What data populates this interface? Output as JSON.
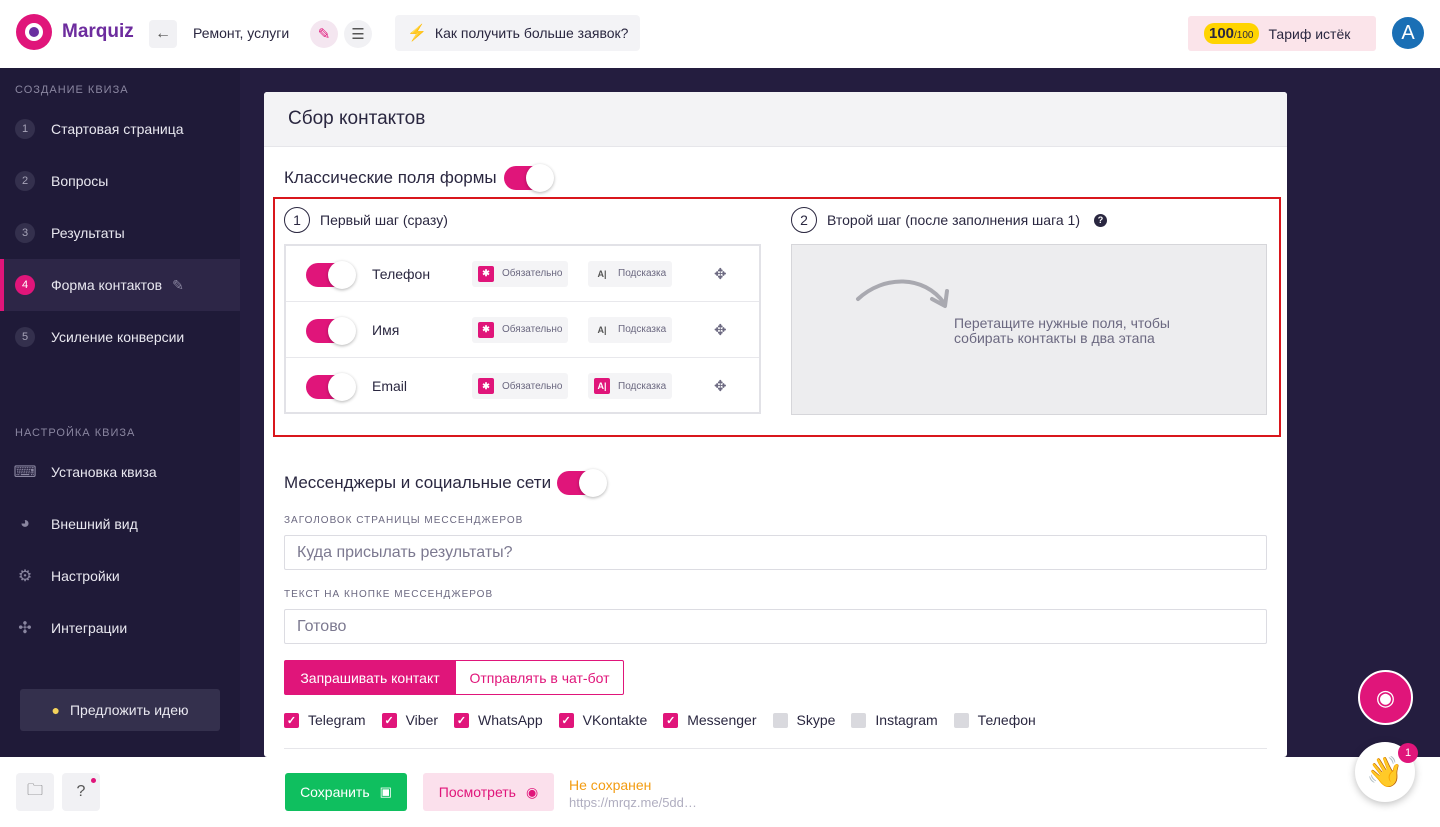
{
  "header": {
    "logo_text": "Marquiz",
    "quiz_name": "Ремонт, услуги",
    "tips_label": "Как получить больше заявок?",
    "tariff_count": "100",
    "tariff_total": "/100",
    "tariff_label": "Тариф истёк",
    "avatar_letter": "A"
  },
  "sidebar": {
    "section_create": "СОЗДАНИЕ КВИЗА",
    "steps": [
      {
        "num": "1",
        "label": "Стартовая страница"
      },
      {
        "num": "2",
        "label": "Вопросы"
      },
      {
        "num": "3",
        "label": "Результаты"
      },
      {
        "num": "4",
        "label": "Форма контактов"
      },
      {
        "num": "5",
        "label": "Усиление конверсии"
      }
    ],
    "section_settings": "НАСТРОЙКА КВИЗА",
    "settings": [
      {
        "label": "Установка квиза",
        "icon": "code-icon"
      },
      {
        "label": "Внешний вид",
        "icon": "palette-icon"
      },
      {
        "label": "Настройки",
        "icon": "gear-icon"
      },
      {
        "label": "Интеграции",
        "icon": "puzzle-icon"
      }
    ],
    "idea_label": "Предложить идею"
  },
  "main": {
    "title": "Сбор контактов",
    "classic_title": "Классические поля формы",
    "step1": {
      "num": "1",
      "label": "Первый шаг (сразу)"
    },
    "step2": {
      "num": "2",
      "label": "Второй шаг (после заполнения шага 1)"
    },
    "fields": [
      {
        "name": "Телефон",
        "required": "Обязательно",
        "hint": "Подсказка",
        "hint_active": false
      },
      {
        "name": "Имя",
        "required": "Обязательно",
        "hint": "Подсказка",
        "hint_active": false
      },
      {
        "name": "Email",
        "required": "Обязательно",
        "hint": "Подсказка",
        "hint_active": true
      }
    ],
    "drop_text_line1": "Перетащите нужные поля, чтобы",
    "drop_text_line2": "собирать контакты в два этапа",
    "messengers_title": "Мессенджеры и социальные сети",
    "messenger_header_label": "ЗАГОЛОВОК СТРАНИЦЫ МЕССЕНДЖЕРОВ",
    "messenger_header_value": "Куда присылать результаты?",
    "messenger_button_label": "ТЕКСТ НА КНОПКЕ МЕССЕНДЖЕРОВ",
    "messenger_button_value": "Готово",
    "mode_on": "Запрашивать контакт",
    "mode_off": "Отправлять в чат-бот",
    "channels": [
      {
        "label": "Telegram",
        "checked": true
      },
      {
        "label": "Viber",
        "checked": true
      },
      {
        "label": "WhatsApp",
        "checked": true
      },
      {
        "label": "VKontakte",
        "checked": true
      },
      {
        "label": "Messenger",
        "checked": true
      },
      {
        "label": "Skype",
        "checked": false
      },
      {
        "label": "Instagram",
        "checked": false
      },
      {
        "label": "Телефон",
        "checked": false
      }
    ]
  },
  "footer": {
    "save_label": "Сохранить",
    "view_label": "Посмотреть",
    "status": "Не сохранен",
    "url": "https://mrqz.me/5dd…"
  },
  "chat_badge": "1",
  "colors": {
    "accent": "#e0157a",
    "save": "#0fbf5f",
    "sidebar": "#1f1a38",
    "status": "#f39c12"
  }
}
